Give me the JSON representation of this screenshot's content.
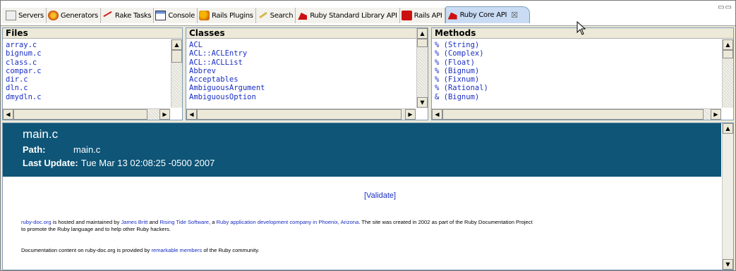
{
  "tabs": [
    {
      "label": "Servers",
      "icon": "servers-icon"
    },
    {
      "label": "Generators",
      "icon": "generators-icon"
    },
    {
      "label": "Rake Tasks",
      "icon": "rake-icon"
    },
    {
      "label": "Console",
      "icon": "console-icon"
    },
    {
      "label": "Rails Plugins",
      "icon": "plugin-icon"
    },
    {
      "label": "Search",
      "icon": "search-icon"
    },
    {
      "label": "Ruby Standard Library API",
      "icon": "ruby-icon"
    },
    {
      "label": "Rails API",
      "icon": "rails-icon"
    },
    {
      "label": "Ruby Core API",
      "icon": "ruby-icon",
      "active": true
    }
  ],
  "panes": {
    "files": {
      "header": "Files",
      "items": [
        "array.c",
        "bignum.c",
        "class.c",
        "compar.c",
        "dir.c",
        "dln.c",
        "dmydln.c"
      ]
    },
    "classes": {
      "header": "Classes",
      "items": [
        "ACL",
        "ACL::ACLEntry",
        "ACL::ACLList",
        "Abbrev",
        "Acceptables",
        "AmbiguousArgument",
        "AmbiguousOption"
      ]
    },
    "methods": {
      "header": "Methods",
      "items": [
        "% (String)",
        "% (Complex)",
        "% (Float)",
        "% (Bignum)",
        "% (Fixnum)",
        "% (Rational)",
        "& (Bignum)"
      ]
    }
  },
  "doc": {
    "title": "main.c",
    "path_label": "Path:",
    "path_value": "main.c",
    "update_label": "Last Update:",
    "update_value": "Tue Mar 13 02:08:25 -0500 2007",
    "validate": "[Validate]",
    "footer1": {
      "site_link": "ruby-doc.org",
      "t1": " is hosted and maintained by ",
      "link_james": "James Britt",
      "t2": " and ",
      "link_rising": "Rising Tide Software",
      "t3": ", a ",
      "link_company": "Ruby application development company in Phoenix, Arizona",
      "t4": ". The site was created in 2002 as part of the Ruby Documentation Project",
      "line2": "to promote the Ruby language and to help other Ruby hackers."
    },
    "footer2": {
      "t1": "Documentation content on ruby-doc.org is provided by ",
      "link_members": "remarkable members",
      "t2": " of the Ruby community."
    }
  },
  "colors": {
    "header_bg": "#0e5577",
    "link": "#1a2ec2",
    "active_tab": "#c9dcf4"
  }
}
